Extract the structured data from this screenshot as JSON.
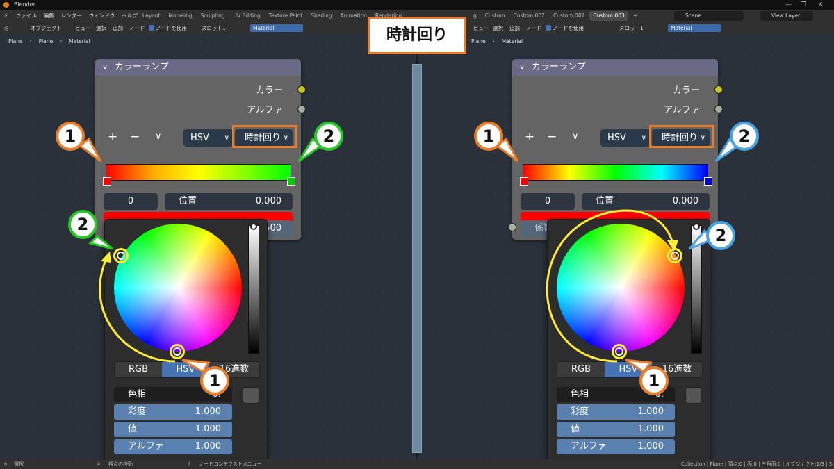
{
  "app_title": "Blender",
  "window_controls": {
    "minimize": "—",
    "maximize": "❐",
    "close": "✕"
  },
  "menu": [
    "ファイル",
    "編集",
    "レンダー",
    "ウィンドウ",
    "ヘルプ"
  ],
  "workspaces_left": [
    "Layout",
    "Modeling",
    "Sculpting",
    "UV Editing",
    "Texture Paint",
    "Shading",
    "Animation",
    "Rendering"
  ],
  "workspaces_right": [
    "g",
    "Custom",
    "Custom.002",
    "Custom.001",
    "Custom.003"
  ],
  "active_workspace": "Custom.003",
  "scene": "Scene",
  "view_layer": "View Layer",
  "editor_header": {
    "mode": "オブジェクト",
    "view": "ビュー",
    "select": "選択",
    "add": "追加",
    "node": "ノード",
    "use_nodes": "ノードを使用",
    "slot": "スロット1",
    "material": "Material"
  },
  "breadcrumb": [
    "Plane",
    "Plane",
    "Material"
  ],
  "callout_title": "時計回り",
  "node": {
    "title": "カラーランプ",
    "outputs": {
      "color": "カラー",
      "alpha": "アルファ"
    },
    "add_btn": "+",
    "remove_btn": "−",
    "menu_chevron": "∨",
    "color_mode": "HSV",
    "interpolation": "時計回り",
    "stop_index": "0",
    "position_label": "位置",
    "position_value": "0.000",
    "factor_label": "係数",
    "factor_value_partial": "500"
  },
  "left": {
    "ramp_end_color": "#00cc00",
    "ramp_gradient": "linear-gradient(90deg,#ff0000,#ffaa00,#ffff00,#88ff00,#00ff00)",
    "badge_color": "#28c828"
  },
  "right": {
    "ramp_end_color": "#0000cc",
    "ramp_gradient": "linear-gradient(90deg,#ff0000,#ffff00,#00ff00,#00ffff,#0000ff)",
    "badge_color": "#4aa3e0"
  },
  "badge_labels": {
    "one": "1",
    "two": "2"
  },
  "badge_one_color": "#e87d2b",
  "picker": {
    "tabs": [
      "RGB",
      "HSV",
      "16進数"
    ],
    "active_tab": "HSV",
    "props": [
      {
        "key": "色相",
        "value": "0."
      },
      {
        "key": "彩度",
        "value": "1.000"
      },
      {
        "key": "値",
        "value": "1.000"
      },
      {
        "key": "アルファ",
        "value": "1.000"
      }
    ]
  },
  "status": {
    "left": "選択",
    "middle": "視点の移動",
    "context": "ノードコンテクストメニュー",
    "right": "Collection | Plane | 頂点:0 | 面:0 | 三角面:0 | オブジェクト:1/3 | 3.4.0"
  },
  "accent_colors": {
    "orange": "#e87d2b",
    "blender_blue": "#4772b3"
  }
}
